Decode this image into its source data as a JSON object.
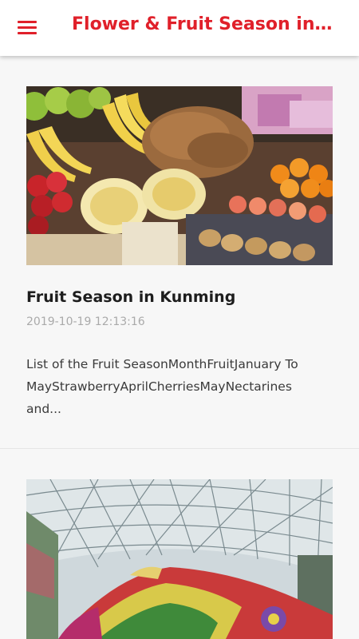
{
  "appbar": {
    "title": "Flower & Fruit Season in Kunming",
    "menu_icon": "hamburger-menu-icon",
    "accent_color": "#e0202a"
  },
  "articles": [
    {
      "title": "Fruit Season in Kunming",
      "date": "2019-10-19 12:13:16",
      "excerpt": "List of the Fruit SeasonMonthFruitJanuary To MayStrawberryAprilCherriesMayNectarines and...",
      "image": "fruit-market-stall-photo"
    },
    {
      "image": "flower-garden-glass-dome-photo"
    }
  ]
}
